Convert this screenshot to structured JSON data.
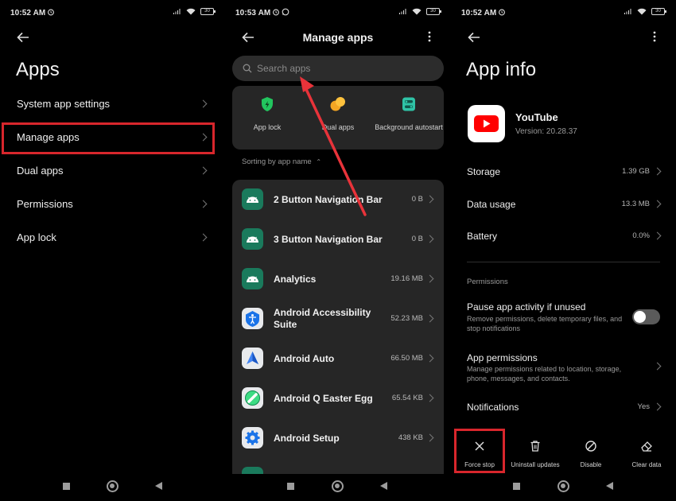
{
  "colors": {
    "highlight": "#d8262c",
    "youtube_red": "#ff0000",
    "android_green": "#3ddc84",
    "shield_green": "#22c55e",
    "dual_orange": "#f5a623"
  },
  "screen1": {
    "time": "10:52 AM",
    "battery": "30",
    "title": "Apps",
    "items": [
      {
        "label": "System app settings"
      },
      {
        "label": "Manage apps"
      },
      {
        "label": "Dual apps"
      },
      {
        "label": "Permissions"
      },
      {
        "label": "App lock"
      }
    ]
  },
  "screen2": {
    "time": "10:53 AM",
    "battery": "30",
    "title": "Manage apps",
    "search_placeholder": "Search apps",
    "quick": [
      {
        "label": "App lock",
        "icon": "shield-icon"
      },
      {
        "label": "Dual apps",
        "icon": "dual-apps-icon"
      },
      {
        "label": "Background autostart",
        "icon": "autostart-icon"
      }
    ],
    "sort_label": "Sorting by app name",
    "apps": [
      {
        "name": "2 Button Navigation Bar",
        "size": "0 B",
        "icon": "android-icon"
      },
      {
        "name": "3 Button Navigation Bar",
        "size": "0 B",
        "icon": "android-icon"
      },
      {
        "name": "Analytics",
        "size": "19.16 MB",
        "icon": "android-icon"
      },
      {
        "name": "Android Accessibility Suite",
        "size": "52.23 MB",
        "icon": "accessibility-icon"
      },
      {
        "name": "Android Auto",
        "size": "66.50 MB",
        "icon": "android-auto-icon"
      },
      {
        "name": "Android Q Easter Egg",
        "size": "65.54 KB",
        "icon": "easter-egg-icon"
      },
      {
        "name": "Android Setup",
        "size": "438 KB",
        "icon": "gear-icon"
      }
    ]
  },
  "screen3": {
    "time": "10:52 AM",
    "battery": "30",
    "title": "App info",
    "app_name": "YouTube",
    "version": "Version: 20.28.37",
    "rows": [
      {
        "label": "Storage",
        "value": "1.39 GB"
      },
      {
        "label": "Data usage",
        "value": "13.3 MB"
      },
      {
        "label": "Battery",
        "value": "0.0%"
      }
    ],
    "section": "Permissions",
    "pause": {
      "title": "Pause app activity if unused",
      "desc": "Remove permissions, delete temporary files, and stop notifications",
      "enabled": false
    },
    "app_permissions": {
      "title": "App permissions",
      "desc": "Manage permissions related to location, storage, phone, messages, and contacts."
    },
    "notifications": {
      "label": "Notifications",
      "value": "Yes"
    },
    "actions": [
      {
        "label": "Force stop",
        "icon": "close-icon"
      },
      {
        "label": "Uninstall updates",
        "icon": "trash-icon"
      },
      {
        "label": "Disable",
        "icon": "disable-icon"
      },
      {
        "label": "Clear data",
        "icon": "eraser-icon"
      }
    ]
  }
}
